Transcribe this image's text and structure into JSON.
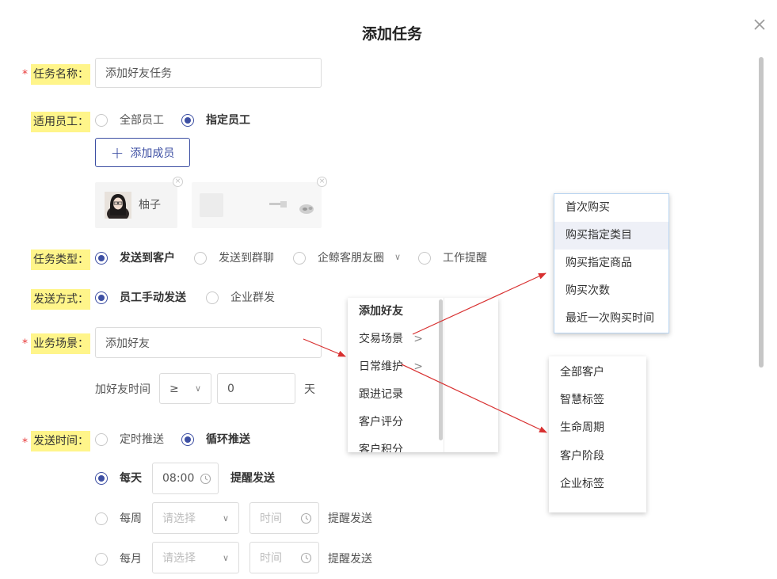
{
  "dialog": {
    "title": "添加任务",
    "close_icon": "close-icon"
  },
  "task_name": {
    "label": "任务名称：",
    "required_mark": "*",
    "value": "添加好友任务"
  },
  "staff": {
    "label": "适用员工：",
    "options": [
      "全部员工",
      "指定员工"
    ],
    "selected": "指定员工",
    "add_member_label": "添加成员",
    "members": [
      {
        "name": "柚子"
      },
      {
        "name": ""
      }
    ]
  },
  "task_type": {
    "label": "任务类型：",
    "options": [
      "发送到客户",
      "发送到群聊",
      "企鲸客朋友圈",
      "工作提醒"
    ],
    "selected": "发送到客户"
  },
  "send_method": {
    "label": "发送方式：",
    "options": [
      "员工手动发送",
      "企业群发"
    ],
    "selected": "员工手动发送"
  },
  "business_scene": {
    "label": "业务场景：",
    "required_mark": "*",
    "value": "添加好友",
    "add_friend_time_label": "加好友时间",
    "operator": "≥",
    "days_value": "0",
    "days_unit": "天"
  },
  "send_time": {
    "label": "发送时间：",
    "required_mark": "*",
    "modes": [
      "定时推送",
      "循环推送"
    ],
    "selected_mode": "循环推送",
    "rows": [
      {
        "freq": "每天",
        "select": "",
        "time": "08:00",
        "reminder": "提醒发送",
        "selected": true
      },
      {
        "freq": "每周",
        "select": "请选择",
        "time": "时间",
        "reminder": "提醒发送",
        "selected": false
      },
      {
        "freq": "每月",
        "select": "请选择",
        "time": "时间",
        "reminder": "提醒发送",
        "selected": false
      }
    ]
  },
  "scene_menu": {
    "items": [
      "添加好友",
      "交易场景",
      "日常维护",
      "跟进记录",
      "客户评分",
      "客户积分"
    ],
    "submenu_arrow": ">"
  },
  "trade_submenu": {
    "items": [
      "首次购买",
      "购买指定类目",
      "购买指定商品",
      "购买次数",
      "最近一次购买时间"
    ],
    "highlighted": "购买指定类目"
  },
  "daily_submenu": {
    "items": [
      "全部客户",
      "智慧标签",
      "生命周期",
      "客户阶段",
      "企业标签"
    ]
  },
  "colors": {
    "primary": "#3d4fa3",
    "highlight": "#fff58a",
    "required": "#e83a3a",
    "annotation": "#d83030"
  }
}
